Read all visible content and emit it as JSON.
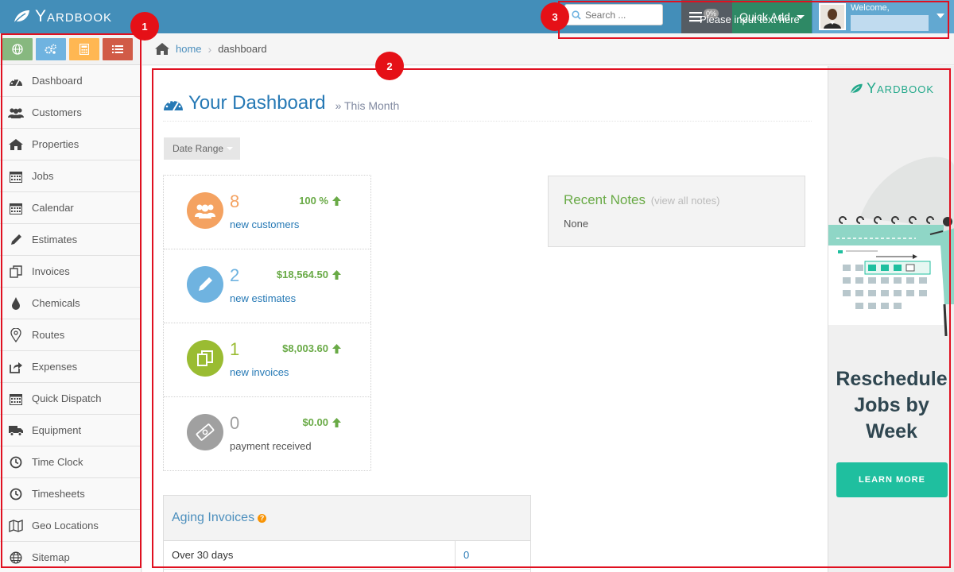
{
  "header": {
    "logo_text": "Yardbook",
    "search_placeholder": "Search ...",
    "tasks_badge": "0%",
    "quick_add_label": "Quick Add",
    "input_hint": "Please input text here",
    "welcome_text": "Welcome,"
  },
  "sidebar": {
    "items": [
      {
        "label": "Dashboard"
      },
      {
        "label": "Customers"
      },
      {
        "label": "Properties"
      },
      {
        "label": "Jobs"
      },
      {
        "label": "Calendar"
      },
      {
        "label": "Estimates"
      },
      {
        "label": "Invoices"
      },
      {
        "label": "Chemicals"
      },
      {
        "label": "Routes"
      },
      {
        "label": "Expenses"
      },
      {
        "label": "Quick Dispatch"
      },
      {
        "label": "Equipment"
      },
      {
        "label": "Time Clock"
      },
      {
        "label": "Timesheets"
      },
      {
        "label": "Geo Locations"
      },
      {
        "label": "Sitemap"
      }
    ]
  },
  "breadcrumb": {
    "home": "home",
    "current": "dashboard"
  },
  "main": {
    "title": "Your Dashboard",
    "subtitle": "» This Month",
    "date_range_label": "Date Range",
    "stats": [
      {
        "count": "8",
        "label": "new customers",
        "value": "100 %",
        "color": "#f4a261"
      },
      {
        "count": "2",
        "label": "new estimates",
        "value": "$18,564.50",
        "color": "#6fb3e0"
      },
      {
        "count": "1",
        "label": "new invoices",
        "value": "$8,003.60",
        "color": "#9abc32"
      },
      {
        "count": "0",
        "label": "payment received",
        "value": "$0.00",
        "color": "#a0a0a0"
      }
    ],
    "notes": {
      "title": "Recent Notes",
      "link": "(view all notes)",
      "body": "None"
    },
    "aging": {
      "title": "Aging Invoices",
      "help": "?",
      "rows": [
        {
          "label": "Over 30 days",
          "value": "0"
        }
      ]
    }
  },
  "ad": {
    "logo_text": "Yardbook",
    "title_line1": "Reschedule",
    "title_line2": "Jobs by",
    "title_line3": "Week",
    "button_label": "LEARN MORE"
  },
  "annotations": [
    "1",
    "2",
    "3"
  ]
}
